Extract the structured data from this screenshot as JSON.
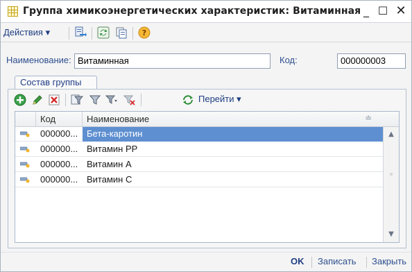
{
  "window": {
    "title": "Группа химикоэнергетических характеристик: Витаминная",
    "controls": {
      "minimize": "_",
      "maximize": "☐",
      "close": "✕"
    }
  },
  "toolbar": {
    "actions_label": "Действия ▾",
    "icons": [
      "post-and-close-icon",
      "refresh-icon",
      "copy-document-icon",
      "help-icon"
    ],
    "help_glyph": "?"
  },
  "form": {
    "name_label": "Наименование:",
    "name_value": "Витаминная",
    "code_label": "Код:",
    "code_value": "000000003"
  },
  "tabs": [
    {
      "label": "Состав группы",
      "active": true
    }
  ],
  "grid_toolbar": {
    "icons": [
      "add-icon",
      "edit-icon",
      "delete-icon",
      "filter-icon",
      "filter-by-value-icon",
      "filter-dropdown-icon",
      "clear-filter-icon",
      "goto-icon"
    ],
    "goto_label": "Перейти ▾"
  },
  "table": {
    "columns": [
      "Код",
      "Наименование"
    ],
    "sort_glyph": "≐",
    "rows": [
      {
        "code": "000000...",
        "name": "Бета-каротин",
        "selected": true
      },
      {
        "code": "000000...",
        "name": "Витамин PP",
        "selected": false
      },
      {
        "code": "000000...",
        "name": "Витамин А",
        "selected": false
      },
      {
        "code": "000000...",
        "name": "Витамин С",
        "selected": false
      }
    ]
  },
  "scrollbar": {
    "up_glyph": "▲",
    "down_glyph": "▼"
  },
  "footer": {
    "ok_label": "OK",
    "save_label": "Записать",
    "close_label": "Закрыть"
  },
  "colors": {
    "accent": "#1e3d82",
    "selection": "#5e8fd0",
    "add": "#3aa14a",
    "delete": "#d62b2b",
    "goto": "#2f8f3a",
    "help": "#e9a21a"
  }
}
